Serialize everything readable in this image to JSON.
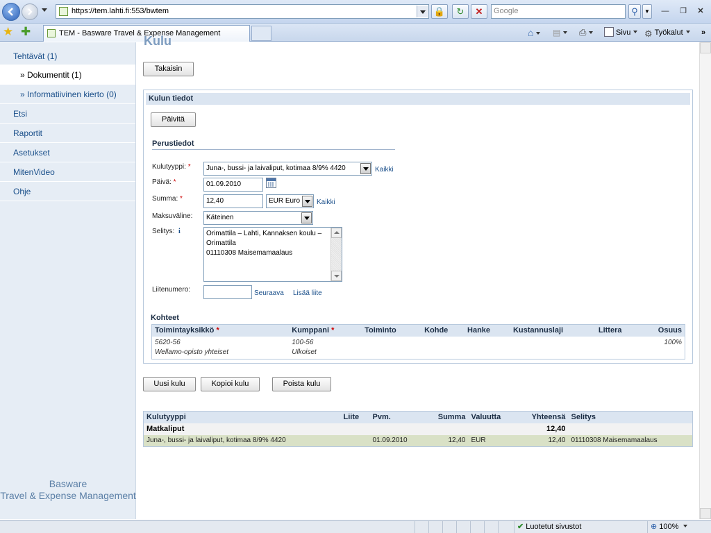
{
  "browser": {
    "url": "https://tem.lahti.fi:553/bwtem",
    "search_placeholder": "Google",
    "tab_title": "TEM - Basware Travel & Expense Management",
    "commands": {
      "page": "Sivu",
      "tools": "Työkalut"
    },
    "status": {
      "zone": "Luotetut sivustot",
      "zoom": "100%"
    }
  },
  "sidebar": {
    "items": [
      {
        "label": "Tehtävät",
        "count": "(1)"
      },
      {
        "label": "» Dokumentit",
        "count": "(1)"
      },
      {
        "label": "» Informatiivinen kierto",
        "count": "(0)"
      },
      {
        "label": "Etsi"
      },
      {
        "label": "Raportit"
      },
      {
        "label": "Asetukset"
      },
      {
        "label": "MitenVideo"
      },
      {
        "label": "Ohje"
      }
    ],
    "brand_line1": "Basware",
    "brand_line2": "Travel & Expense Management"
  },
  "page": {
    "title": "Kulu",
    "back_button": "Takaisin",
    "panel_title": "Kulun tiedot",
    "update_button": "Päivitä",
    "basic_info_title": "Perustiedot",
    "form": {
      "expense_type_label": "Kulutyyppi:",
      "expense_type_value": "Juna-, bussi- ja laivaliput, kotimaa 8/9%  4420",
      "all_link": "Kaikki",
      "date_label": "Päivä:",
      "date_value": "01.09.2010",
      "amount_label": "Summa:",
      "amount_value": "12,40",
      "currency_value": "EUR Euro",
      "payment_label": "Maksuväline:",
      "payment_value": "Käteinen",
      "desc_label": "Selitys:",
      "desc_info": "i",
      "desc_line1": "Orimattila – Lahti, Kannaksen koulu –",
      "desc_line2": "Orimattila",
      "desc_line3": "01110308 Maisemamaalaus",
      "attach_label": "Liitenumero:",
      "attach_value": "",
      "next_link": "Seuraava",
      "add_attach_link": "Lisää liite",
      "required_mark": "*"
    },
    "targets": {
      "title": "Kohteet",
      "headers": [
        "Toimintayksikkö",
        "Kumppani",
        "Toiminto",
        "Kohde",
        "Hanke",
        "Kustannuslaji",
        "Littera",
        "Osuus"
      ],
      "row": {
        "unit_code": "5620-56",
        "unit_name": "Wellamo-opisto yhteiset",
        "partner_code": "100-56",
        "partner_name": "Ulkoiset",
        "share": "100%"
      }
    },
    "actions": {
      "new": "Uusi kulu",
      "copy": "Kopioi kulu",
      "delete": "Poista kulu"
    },
    "summary": {
      "headers": [
        "Kulutyyppi",
        "Liite",
        "Pvm.",
        "Summa",
        "Valuutta",
        "Yhteensä",
        "Selitys"
      ],
      "group": {
        "name": "Matkaliput",
        "total": "12,40"
      },
      "row": {
        "type": "Juna-, bussi- ja laivaliput, kotimaa 8/9% 4420",
        "attachment": "",
        "date": "01.09.2010",
        "amount": "12,40",
        "currency": "EUR",
        "total": "12,40",
        "desc": "01110308 Maisemamaalaus"
      }
    }
  }
}
